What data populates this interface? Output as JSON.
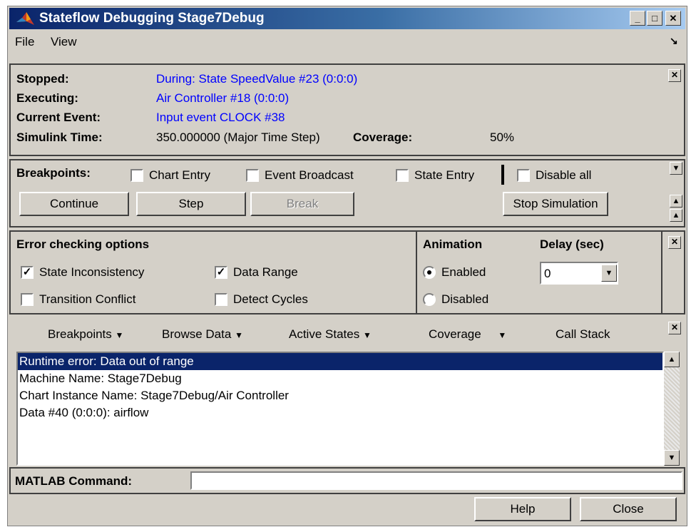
{
  "window": {
    "title": "Stateflow Debugging Stage7Debug",
    "minimize": "_",
    "maximize": "□",
    "close": "✕"
  },
  "menu": {
    "file": "File",
    "view": "View",
    "corner_icon": "dock-arrow-icon"
  },
  "status": {
    "stopped_label": "Stopped:",
    "stopped_value": "During: State SpeedValue #23 (0:0:0)",
    "executing_label": "Executing:",
    "executing_value": "Air Controller #18 (0:0:0)",
    "event_label": "Current Event:",
    "event_value": "Input event CLOCK #38",
    "time_label": "Simulink Time:",
    "time_value": "350.000000 (Major Time Step)",
    "coverage_label": "Coverage:",
    "coverage_value": "50%"
  },
  "breakpoints": {
    "label": "Breakpoints:",
    "chart_entry": "Chart Entry",
    "event_broadcast": "Event Broadcast",
    "state_entry": "State Entry",
    "disable_all": "Disable all"
  },
  "controls": {
    "continue": "Continue",
    "step": "Step",
    "break": "Break",
    "stop_simulation": "Stop Simulation"
  },
  "error_checking": {
    "title": "Error checking options",
    "state_inconsistency": "State Inconsistency",
    "state_inconsistency_checked": true,
    "data_range": "Data Range",
    "data_range_checked": true,
    "transition_conflict": "Transition Conflict",
    "transition_conflict_checked": false,
    "detect_cycles": "Detect Cycles",
    "detect_cycles_checked": false
  },
  "animation": {
    "title": "Animation",
    "enabled": "Enabled",
    "disabled": "Disabled",
    "selected": "Enabled"
  },
  "delay": {
    "title": "Delay (sec)",
    "value": "0"
  },
  "toolbar": {
    "breakpoints": "Breakpoints",
    "browse_data": "Browse Data",
    "active_states": "Active States",
    "coverage": "Coverage",
    "call_stack": "Call Stack"
  },
  "output": {
    "lines": [
      "Runtime error: Data out of range",
      "Machine Name: Stage7Debug",
      "Chart Instance Name: Stage7Debug/Air Controller",
      "Data #40 (0:0:0): airflow"
    ],
    "selected_index": 0
  },
  "command": {
    "label": "MATLAB Command:",
    "value": ""
  },
  "footer": {
    "help": "Help",
    "close": "Close"
  },
  "colors": {
    "titlebar": "#0a246a",
    "value_text": "#0000ff",
    "window_bg": "#d4d0c8",
    "selection": "#0a246a"
  }
}
